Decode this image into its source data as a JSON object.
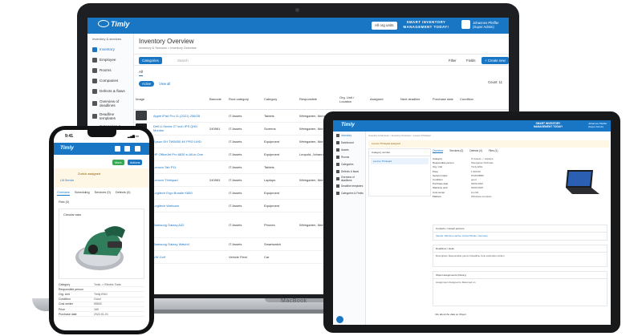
{
  "laptop": {
    "brand_label": "MacBook",
    "header": {
      "logo": "Timly",
      "orgs_button": "All org units",
      "banner_line1": "SMART INVENTORY",
      "banner_line2": "MANAGEMENT TODAY!",
      "user_name": "Johannes Pfeiffer",
      "user_role": "(Super Admin)"
    },
    "sidebar": {
      "section": "Inventory & services",
      "items": [
        {
          "label": "Inventory",
          "icon": "box-icon",
          "active": true
        },
        {
          "label": "Employee",
          "icon": "people-icon"
        },
        {
          "label": "Rooms",
          "icon": "room-icon"
        },
        {
          "label": "Companies",
          "icon": "company-icon"
        },
        {
          "label": "Defects & flaws",
          "icon": "wrench-icon"
        },
        {
          "label": "Overview of deadlines",
          "icon": "calendar-icon"
        },
        {
          "label": "Deadline templates",
          "icon": "template-icon"
        },
        {
          "label": "Categories & Fields",
          "icon": "tag-icon"
        }
      ]
    },
    "main": {
      "title": "Inventory Overview",
      "breadcrumb": "Inventory & Services  >  Inventory Overview",
      "categories_button": "Categories",
      "search_placeholder": "Search",
      "filter_label": "Filter",
      "fields_label": "Fields",
      "create_button": "+ Create new",
      "tab_all": "All",
      "active_toggle": "Active",
      "view_all": "View all",
      "count": "Count: 11",
      "columns": [
        "Image",
        "Barcode",
        "Root category",
        "Category",
        "Responsible",
        "Org. Unit / Location",
        "Assigned",
        "Next deadline",
        "Purchase date",
        "Condition"
      ],
      "rows": [
        {
          "name": "Apple iPad Pro 11 (2021) 256GB",
          "barcode": "",
          "root": "IT Assets",
          "category": "Tablets",
          "responsible": "Weingarten, Nicholas",
          "org": "Timly ENG"
        },
        {
          "name": "Dell U-Series 27 inch IPS QHD Monitor",
          "barcode": "240961",
          "root": "IT Assets",
          "category": "Screens",
          "responsible": "Weingarten, Nicholas",
          "org": ""
        },
        {
          "name": "Epson EH TW5650 4K PRO UHD",
          "barcode": "",
          "root": "IT Assets",
          "category": "Equipment",
          "responsible": "Weingarten, Nicholas",
          "org": ""
        },
        {
          "name": "HP OfficeJet Pro 6830 e-All-in-One",
          "barcode": "",
          "root": "IT Assets",
          "category": "Equipment",
          "responsible": "Leopold, Johanna",
          "org": ""
        },
        {
          "name": "Lenovo Tab P11",
          "barcode": "",
          "root": "IT Assets",
          "category": "Tablets",
          "responsible": "",
          "org": ""
        },
        {
          "name": "Lenovo Thinkpad",
          "barcode": "240963",
          "root": "IT Assets",
          "category": "Laptops",
          "responsible": "Weingarten, Nicholas",
          "org": ""
        },
        {
          "name": "Logitech Ergo Bundle K860",
          "barcode": "",
          "root": "IT Assets",
          "category": "Equipment",
          "responsible": "",
          "org": ""
        },
        {
          "name": "Logitech Webcam",
          "barcode": "",
          "root": "IT Assets",
          "category": "Equipment",
          "responsible": "",
          "org": ""
        },
        {
          "name": "Samsung Galaxy A32",
          "barcode": "",
          "root": "IT Assets",
          "category": "Phones",
          "responsible": "Weingarten, Nicholas",
          "org": ""
        },
        {
          "name": "Samsung Galaxy Watch4",
          "barcode": "",
          "root": "IT Assets",
          "category": "Smartwatch",
          "responsible": "",
          "org": ""
        },
        {
          "name": "VW Golf",
          "barcode": "",
          "root": "Vehicle Fleet",
          "category": "Car",
          "responsible": "",
          "org": ""
        }
      ]
    }
  },
  "tablet": {
    "header": {
      "logo": "Timly",
      "banner_line1": "SMART INVENTORY",
      "banner_line2": "MANAGEMENT TODAY!",
      "user_name": "Johannes Pfeiffer",
      "user_role": "(Super Admin)"
    },
    "sidebar_items": [
      "Inventory",
      "Dashboard",
      "Assets",
      "Rooms",
      "Categories",
      "Defects & flaws",
      "Overview of deadlines",
      "Deadline templates",
      "Categories & Fields"
    ],
    "breadcrumb": "Inventory & Services  >  Inventory Overview  >  Lenovo Thinkpad",
    "assign_notice": "Lenovo Thinkpad assigned",
    "panel_header": "Category number",
    "panel_item": "Lenovo Thinkpad",
    "tabs": [
      "Overview",
      "Services (0)",
      "Defects (0)",
      "Files (1)"
    ],
    "fields": [
      {
        "k": "Category",
        "v": "IT Assets -> Laptops"
      },
      {
        "k": "Responsible person",
        "v": "Weingarten Nicholas"
      },
      {
        "k": "Org. Unit",
        "v": "Timly ENG"
      },
      {
        "k": "Price",
        "v": "1,500.00"
      },
      {
        "k": "Serial number",
        "v": "PF2KMB8N"
      },
      {
        "k": "Condition",
        "v": "good"
      },
      {
        "k": "Purchase date",
        "v": "09/01/2022"
      },
      {
        "k": "Warranty until",
        "v": "09/01/2025"
      },
      {
        "k": "Cost center",
        "v": "12.234"
      },
      {
        "k": "Platform",
        "v": "Windows-computer"
      }
    ],
    "sections": [
      {
        "title": "Contacts / contact persons",
        "body": "Vendor    Jasmine Lambe, Arrival Works, Germany"
      },
      {
        "title": "Deadlines / tasks",
        "body": "Description    Responsible person    Deadline    Cost estimation    Action"
      },
      {
        "title": "Object assignments (history)",
        "body": "Assignment    Assigned to    Returned on"
      },
      {
        "title": "Info about the data on Object",
        "body": ""
      }
    ]
  },
  "phone": {
    "time": "9:41",
    "header_logo": "Timly",
    "btn_more": "More",
    "btn_actions": "Actions",
    "assign_text": "Zurich assigned",
    "assign_chip": "Lift Service",
    "tabs": [
      "Overview",
      "Scheduling",
      "Services (0)",
      "Defects (0)"
    ],
    "files": "Files (0)",
    "card_caption": "Circular saw",
    "props": [
      {
        "k": "Category",
        "v": "Tools -> Electric Tools"
      },
      {
        "k": "Responsible person",
        "v": ""
      },
      {
        "k": "Org. Unit",
        "v": "Timly ENG"
      },
      {
        "k": "Condition",
        "v": "Good"
      },
      {
        "k": "Cost center",
        "v": "55500"
      },
      {
        "k": "Price",
        "v": "169"
      },
      {
        "k": "Purchase date",
        "v": "2022-01-01"
      }
    ]
  }
}
